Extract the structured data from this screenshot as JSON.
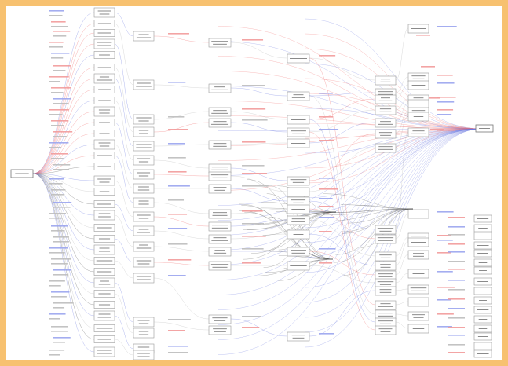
{
  "diagram": {
    "colors": {
      "frame": "#f7c170",
      "canvas": "#ffffff",
      "edge_red": "#f06a6a",
      "edge_blue": "#6b78e0",
      "edge_grey": "#b8b8b8",
      "node_border": "#9a9a9a"
    },
    "note": ""
  }
}
